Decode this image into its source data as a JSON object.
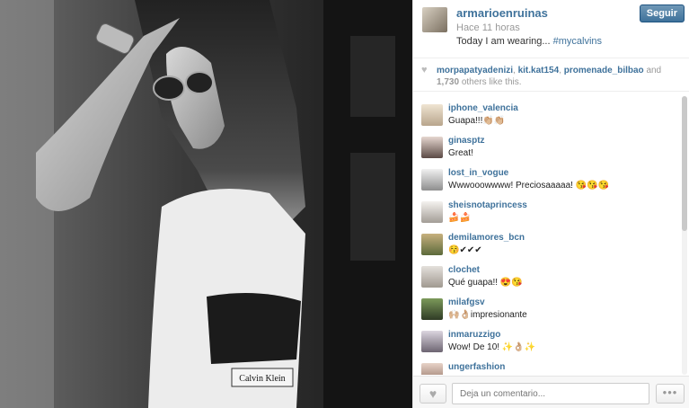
{
  "post": {
    "username": "armarioenruinas",
    "time": "Hace 11 horas",
    "caption_text": "Today I am wearing...",
    "caption_tag": "#mycalvins",
    "follow_label": "Seguir",
    "photo_text": "Calvin Klein"
  },
  "likes": {
    "users": [
      "morpapatyadenizi",
      "kit.kat154",
      "promenade_bilbao"
    ],
    "and": "and",
    "count": "1,730",
    "suffix": "others like this."
  },
  "comments": [
    {
      "user": "iphone_valencia",
      "text": "Guapa!!!👏🏼👏🏼"
    },
    {
      "user": "ginasptz",
      "text": "Great!"
    },
    {
      "user": "lost_in_vogue",
      "text": "Wwwooowwww! Preciosaaaaa! 😘😘😘"
    },
    {
      "user": "sheisnotaprincess",
      "text": "🍰🍰"
    },
    {
      "user": "demilamores_bcn",
      "text": "😚✔✔✔"
    },
    {
      "user": "clochet",
      "text": "Qué guapa!! 😍😘"
    },
    {
      "user": "milafgsv",
      "text": "🙌🏼👌🏼impresionante"
    },
    {
      "user": "inmaruzzigo",
      "text": "Wow! De 10! ✨👌🏼✨"
    },
    {
      "user": "ungerfashion",
      "text": ""
    }
  ],
  "footer": {
    "placeholder": "Deja un comentario...",
    "more_label": "•••"
  },
  "colors": {
    "link": "#3f729b",
    "follow_button": "#3f729b"
  }
}
